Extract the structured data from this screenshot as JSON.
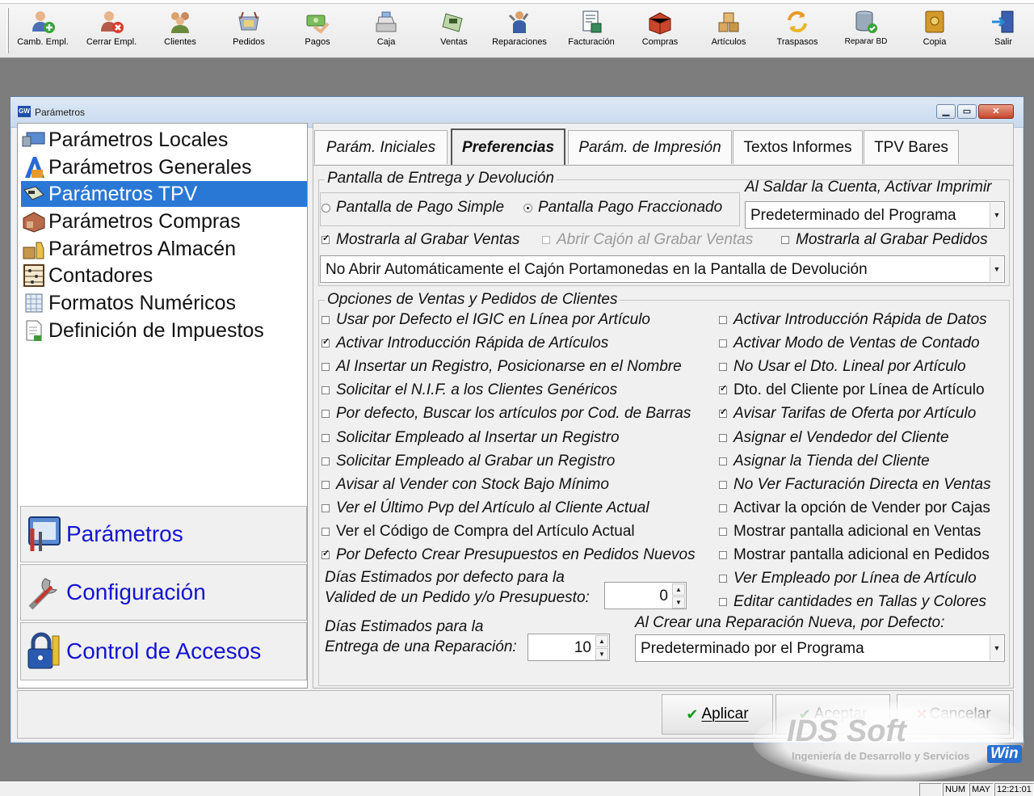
{
  "toolbar": {
    "buttons": [
      {
        "label": "Camb. Empl.",
        "icon": "user-add-icon"
      },
      {
        "label": "Cerrar Empl.",
        "icon": "user-remove-icon"
      },
      {
        "label": "Clientes",
        "icon": "clients-icon"
      },
      {
        "label": "Pedidos",
        "icon": "orders-icon"
      },
      {
        "label": "Pagos",
        "icon": "payments-icon"
      },
      {
        "label": "Caja",
        "icon": "cash-register-icon"
      },
      {
        "label": "Ventas",
        "icon": "sales-icon"
      },
      {
        "label": "Reparaciones",
        "icon": "repairs-icon"
      },
      {
        "label": "Facturación",
        "icon": "invoicing-icon"
      },
      {
        "label": "Compras",
        "icon": "purchases-icon"
      },
      {
        "label": "Artículos",
        "icon": "articles-icon"
      },
      {
        "label": "Traspasos",
        "icon": "transfers-icon"
      },
      {
        "label": "Reparar BD",
        "icon": "repair-database-icon"
      },
      {
        "label": "Copia",
        "icon": "backup-icon"
      },
      {
        "label": "Salir",
        "icon": "exit-icon"
      }
    ]
  },
  "window": {
    "icon_text": "GW",
    "title": "Parámetros"
  },
  "nav": {
    "items": [
      {
        "label": "Parámetros Locales",
        "icon": "local-parameters-icon",
        "selected": false
      },
      {
        "label": "Parámetros Generales",
        "icon": "general-parameters-icon",
        "selected": false
      },
      {
        "label": "Parámetros TPV",
        "icon": "pos-parameters-icon",
        "selected": true
      },
      {
        "label": "Parámetros Compras",
        "icon": "purchase-parameters-icon",
        "selected": false
      },
      {
        "label": "Parámetros Almacén",
        "icon": "warehouse-parameters-icon",
        "selected": false
      },
      {
        "label": "Contadores",
        "icon": "counters-icon",
        "selected": false
      },
      {
        "label": "Formatos Numéricos",
        "icon": "number-formats-icon",
        "selected": false
      },
      {
        "label": "Definición de Impuestos",
        "icon": "taxes-icon",
        "selected": false
      }
    ],
    "sections": [
      {
        "label": "Parámetros",
        "icon": "parameters-section-icon"
      },
      {
        "label": "Configuración",
        "icon": "wrench-icon"
      },
      {
        "label": "Control de Accesos",
        "icon": "padlock-icon"
      }
    ]
  },
  "tabs": [
    {
      "label": "Parám. Iniciales",
      "active": false
    },
    {
      "label": "Preferencias",
      "active": true
    },
    {
      "label": "Parám. de Impresión",
      "active": false
    },
    {
      "label": "Textos Informes",
      "active": false
    },
    {
      "label": "TPV Bares",
      "active": false
    }
  ],
  "delivery": {
    "title": "Pantalla de Entrega y Devolución",
    "radio_simple": "Pantalla de Pago Simple",
    "radio_split": "Pantalla Pago Fraccionado",
    "selected_radio": "split",
    "print_title": "Al Saldar la Cuenta, Activar  Imprimir",
    "print_value": "Predeterminado del Programa",
    "show_on_sales": "Mostrarla al Grabar Ventas",
    "open_drawer": "Abrir Cajón al Grabar Ventas",
    "show_on_orders": "Mostrarla al Grabar Pedidos",
    "drawer_value": "No Abrir Automáticamente el Cajón Portamonedas en la Pantalla de Devolución"
  },
  "options": {
    "title": "Opciones de Ventas y Pedidos de Clientes",
    "left": [
      {
        "label": "Usar por Defecto el IGIC en Línea por Artículo",
        "checked": false,
        "italic": true
      },
      {
        "label": "Activar Introducción Rápida de Artículos",
        "checked": true,
        "italic": true
      },
      {
        "label": "Al Insertar un Registro, Posicionarse en el Nombre",
        "checked": false,
        "italic": true
      },
      {
        "label": "Solicitar el N.I.F. a los Clientes Genéricos",
        "checked": false,
        "italic": true
      },
      {
        "label": "Por defecto, Buscar los artículos por Cod. de Barras",
        "checked": false,
        "italic": true
      },
      {
        "label": "Solicitar Empleado al Insertar un Registro",
        "checked": false,
        "italic": true
      },
      {
        "label": "Solicitar Empleado al Grabar un Registro",
        "checked": false,
        "italic": true
      },
      {
        "label": "Avisar al Vender con Stock Bajo Mínimo",
        "checked": false,
        "italic": true
      },
      {
        "label": "Ver el Último Pvp del Artículo al Cliente Actual",
        "checked": false,
        "italic": true
      },
      {
        "label": "Ver el Código de Compra del Artículo Actual",
        "checked": false,
        "italic": false
      },
      {
        "label": "Por Defecto Crear Presupuestos en Pedidos Nuevos",
        "checked": true,
        "italic": true
      }
    ],
    "right": [
      {
        "label": "Activar Introducción Rápida de Datos",
        "checked": false,
        "italic": true
      },
      {
        "label": "Activar Modo de Ventas de Contado",
        "checked": false,
        "italic": true
      },
      {
        "label": "No Usar el Dto. Lineal por Artículo",
        "checked": false,
        "italic": true
      },
      {
        "label": "Dto. del Cliente por Línea de Artículo",
        "checked": true,
        "italic": false
      },
      {
        "label": "Avisar Tarifas de Oferta por Artículo",
        "checked": true,
        "italic": true
      },
      {
        "label": "Asignar el Vendedor del Cliente",
        "checked": false,
        "italic": true
      },
      {
        "label": "Asignar la Tienda del Cliente",
        "checked": false,
        "italic": true
      },
      {
        "label": "No Ver Facturación Directa en Ventas",
        "checked": false,
        "italic": true
      },
      {
        "label": "Activar la opción de Vender por Cajas",
        "checked": false,
        "italic": false
      },
      {
        "label": "Mostrar pantalla adicional en Ventas",
        "checked": false,
        "italic": false
      },
      {
        "label": "Mostrar pantalla adicional en Pedidos",
        "checked": false,
        "italic": false
      },
      {
        "label": "Ver Empleado por Línea de Artículo",
        "checked": false,
        "italic": true
      },
      {
        "label": "Editar cantidades en Tallas y Colores",
        "checked": false,
        "italic": true
      }
    ],
    "validity_label_1": "Días Estimados por defecto para la",
    "validity_label_2": "Valided de un Pedido y/o Presupuesto:",
    "validity_value": "0",
    "repair_label_1": "Días Estimados para la",
    "repair_label_2": "Entrega de una Reparación:",
    "repair_value": "10",
    "new_repair_label": "Al Crear una Reparación Nueva, por Defecto:",
    "new_repair_value": "Predeterminado por el Programa"
  },
  "buttons": {
    "apply": "Aplicar",
    "accept": "Aceptar",
    "cancel": "Cancelar"
  },
  "brand": {
    "name": "IDS Soft",
    "tagline": "Ingeniería de Desarrollo y Servicios",
    "badge": "Win"
  },
  "status": {
    "num": "NUM",
    "may": "MAY",
    "time": "12:21:01"
  }
}
